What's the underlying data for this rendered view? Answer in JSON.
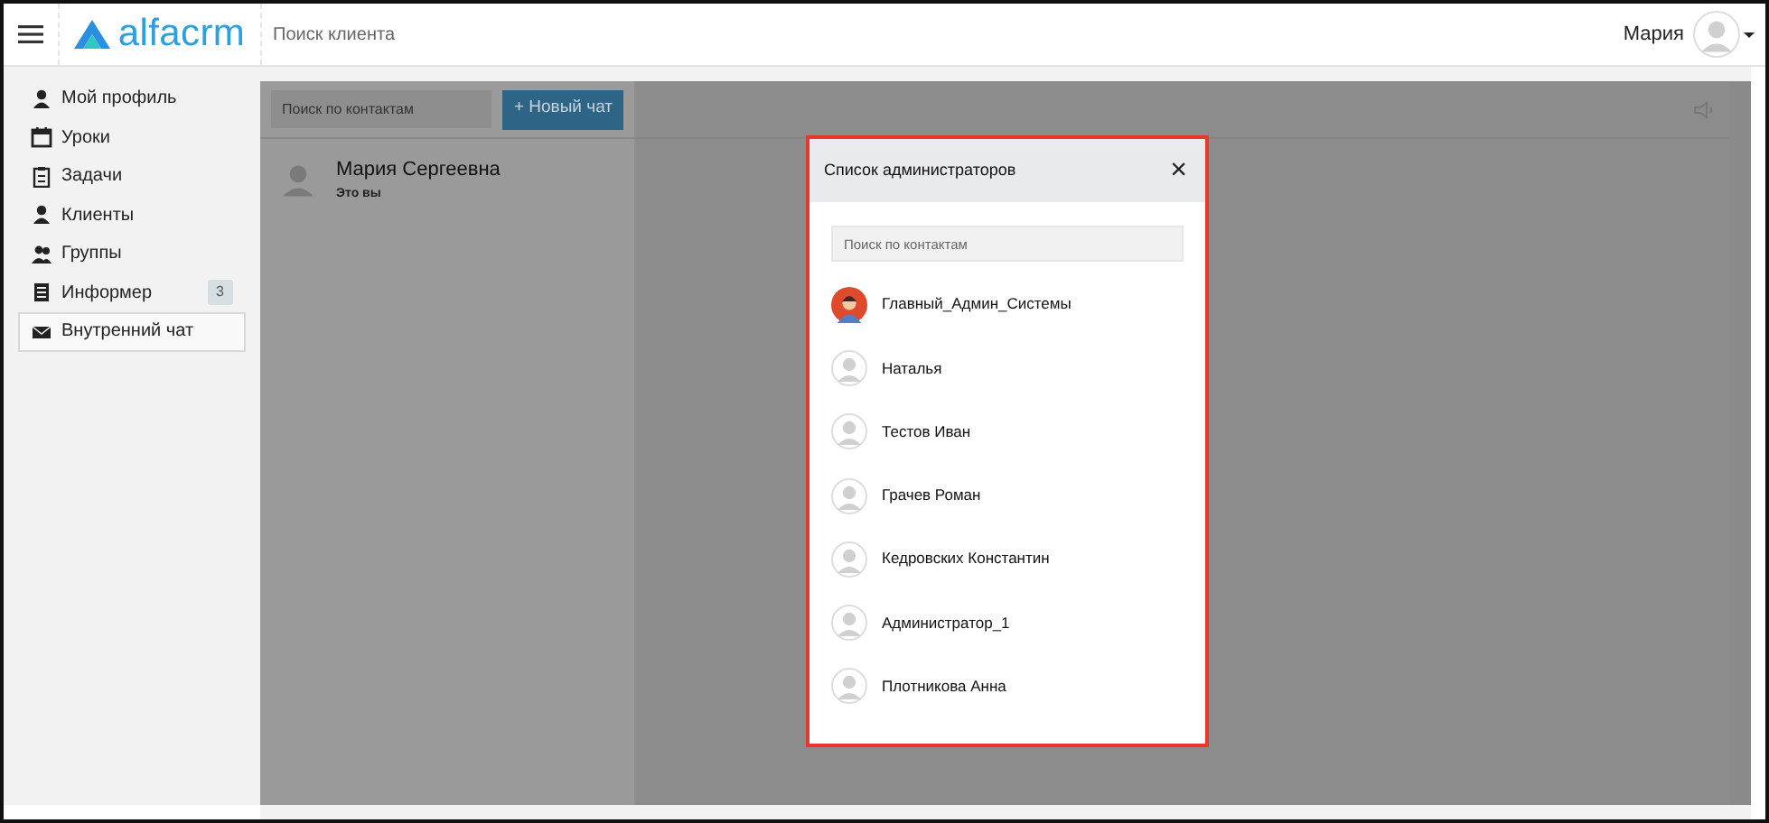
{
  "header": {
    "logo": "alfacrm",
    "search_placeholder": "Поиск клиента",
    "user_name": "Мария"
  },
  "sidebar": {
    "items": [
      {
        "kind": "person",
        "label": "Мой профиль",
        "selected": false
      },
      {
        "kind": "calendar",
        "label": "Уроки",
        "selected": false
      },
      {
        "kind": "clipboard",
        "label": "Задачи",
        "selected": false
      },
      {
        "kind": "person",
        "label": "Клиенты",
        "selected": false
      },
      {
        "kind": "people",
        "label": "Группы",
        "selected": false
      },
      {
        "kind": "list",
        "label": "Информер",
        "badge": "3",
        "selected": false
      },
      {
        "kind": "envelope",
        "label": "Внутренний чат",
        "selected": true
      }
    ]
  },
  "chat_list": {
    "search_placeholder": "Поиск по контактам",
    "new_chat_button": "+ Новый чат",
    "contacts": [
      {
        "name": "Мария Сергеевна",
        "note": "Это вы"
      }
    ]
  },
  "modal": {
    "title": "Список администраторов",
    "close": "×",
    "search_placeholder": "Поиск по контактам",
    "admins": [
      {
        "name": "Главный_Админ_Системы",
        "kind": "colored"
      },
      {
        "name": "Наталья",
        "kind": "default"
      },
      {
        "name": "Тестов Иван",
        "kind": "default"
      },
      {
        "name": "Грачев Роман",
        "kind": "default"
      },
      {
        "name": "Кедровских Константин",
        "kind": "default"
      },
      {
        "name": "Администратор_1",
        "kind": "default"
      },
      {
        "name": "Плотникова Анна",
        "kind": "default"
      }
    ]
  }
}
